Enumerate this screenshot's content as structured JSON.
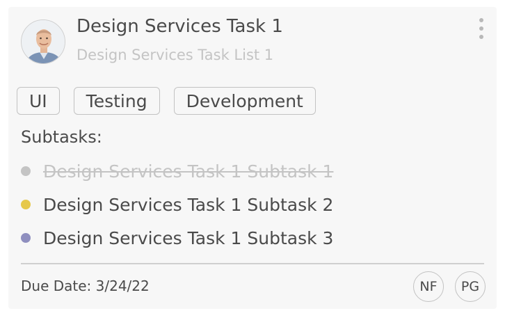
{
  "task": {
    "title": "Design Services Task 1",
    "list_name": "Design Services Task List 1"
  },
  "tags": [
    {
      "label": "UI"
    },
    {
      "label": "Testing"
    },
    {
      "label": "Development"
    }
  ],
  "subtasks_label": "Subtasks:",
  "subtasks": [
    {
      "label": "Design Services Task 1 Subtask 1",
      "completed": true,
      "color": "#c4c4c4"
    },
    {
      "label": "Design Services Task 1 Subtask 2",
      "completed": false,
      "color": "#e6c84a"
    },
    {
      "label": "Design Services Task 1 Subtask 3",
      "completed": false,
      "color": "#8f8fbf"
    }
  ],
  "due_date": "Due Date: 3/24/22",
  "assignees": [
    {
      "initials": "NF"
    },
    {
      "initials": "PG"
    }
  ],
  "icons": {
    "avatar": "user-avatar-photo",
    "menu": "more-vertical-icon"
  }
}
